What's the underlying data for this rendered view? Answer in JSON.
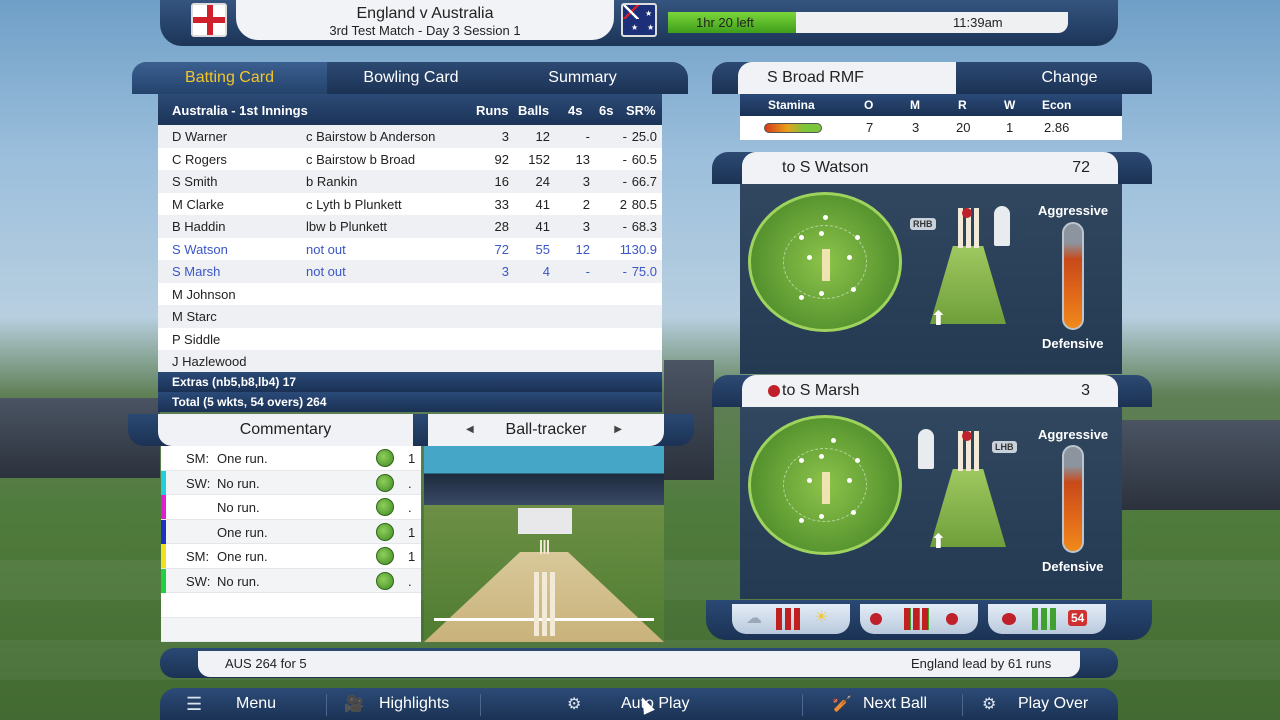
{
  "header": {
    "match_title": "England v Australia",
    "match_subtitle": "3rd Test Match - Day 3 Session 1",
    "time_left": "1hr 20 left",
    "clock": "11:39am",
    "progress_fraction": 0.32
  },
  "tabs": [
    "Batting Card",
    "Bowling Card",
    "Summary"
  ],
  "batting_card": {
    "innings_label": "Australia - 1st Innings",
    "columns": [
      "Runs",
      "Balls",
      "4s",
      "6s",
      "SR%"
    ],
    "rows": [
      {
        "name": "D Warner",
        "dismissal": "c Bairstow b Anderson",
        "runs": "3",
        "balls": "12",
        "fours": "-",
        "sixes": "-",
        "sr": "25.0"
      },
      {
        "name": "C Rogers",
        "dismissal": "c Bairstow b Broad",
        "runs": "92",
        "balls": "152",
        "fours": "13",
        "sixes": "-",
        "sr": "60.5"
      },
      {
        "name": "S Smith",
        "dismissal": "b Rankin",
        "runs": "16",
        "balls": "24",
        "fours": "3",
        "sixes": "-",
        "sr": "66.7"
      },
      {
        "name": "M Clarke",
        "dismissal": "c Lyth b Plunkett",
        "runs": "33",
        "balls": "41",
        "fours": "2",
        "sixes": "2",
        "sr": "80.5"
      },
      {
        "name": "B Haddin",
        "dismissal": "lbw b Plunkett",
        "runs": "28",
        "balls": "41",
        "fours": "3",
        "sixes": "-",
        "sr": "68.3"
      },
      {
        "name": "S Watson",
        "dismissal": "not out",
        "runs": "72",
        "balls": "55",
        "fours": "12",
        "sixes": "1",
        "sr": "130.9"
      },
      {
        "name": "S Marsh",
        "dismissal": "not out",
        "runs": "3",
        "balls": "4",
        "fours": "-",
        "sixes": "-",
        "sr": "75.0"
      },
      {
        "name": "M Johnson",
        "dismissal": "",
        "runs": "",
        "balls": "",
        "fours": "",
        "sixes": "",
        "sr": ""
      },
      {
        "name": "M Starc",
        "dismissal": "",
        "runs": "",
        "balls": "",
        "fours": "",
        "sixes": "",
        "sr": ""
      },
      {
        "name": "P Siddle",
        "dismissal": "",
        "runs": "",
        "balls": "",
        "fours": "",
        "sixes": "",
        "sr": ""
      },
      {
        "name": "J Hazlewood",
        "dismissal": "",
        "runs": "",
        "balls": "",
        "fours": "",
        "sixes": "",
        "sr": ""
      }
    ],
    "extras": "Extras (nb5,b8,lb4) 17",
    "total": "Total (5 wkts, 54 overs) 264"
  },
  "commentary": {
    "tab_label": "Commentary",
    "tracker_label": "Ball-tracker",
    "rows": [
      {
        "batter": "SM:",
        "text": "One run.",
        "runs": "1",
        "color": "#ffffff"
      },
      {
        "batter": "SW:",
        "text": "No run.",
        "runs": ".",
        "color": "#20d0e0"
      },
      {
        "batter": "",
        "text": "No run.",
        "runs": ".",
        "color": "#e020d0"
      },
      {
        "batter": "",
        "text": "One run.",
        "runs": "1",
        "color": "#2030c0"
      },
      {
        "batter": "SM:",
        "text": "One run.",
        "runs": "1",
        "color": "#f0e020"
      },
      {
        "batter": "SW:",
        "text": "No run.",
        "runs": ".",
        "color": "#20d040"
      }
    ]
  },
  "bowler": {
    "name": "S Broad RMF",
    "change_label": "Change",
    "columns": [
      "Stamina",
      "O",
      "M",
      "R",
      "W",
      "Econ"
    ],
    "overs": "7",
    "maidens": "3",
    "runs": "20",
    "wickets": "1",
    "econ": "2.86"
  },
  "field1": {
    "label": "to S Watson",
    "value": "72",
    "hand": "RHB",
    "aggressive": "Aggressive",
    "defensive": "Defensive"
  },
  "field2": {
    "label": "to S Marsh",
    "value": "3",
    "hand": "LHB",
    "aggressive": "Aggressive",
    "defensive": "Defensive"
  },
  "icons_bar": {
    "count_badge": "54"
  },
  "status": {
    "score": "AUS  264 for 5",
    "lead": "England lead by 61 runs"
  },
  "menu": {
    "menu": "Menu",
    "highlights": "Highlights",
    "auto_play": "Auto Play",
    "next_ball": "Next Ball",
    "play_over": "Play Over"
  }
}
